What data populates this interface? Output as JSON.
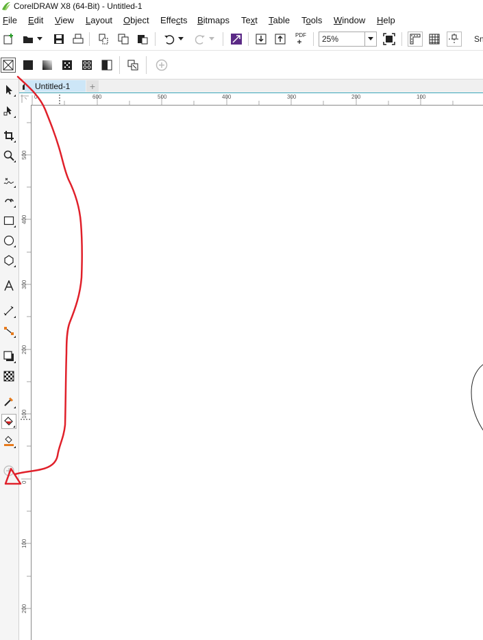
{
  "window": {
    "title": "CorelDRAW X8 (64-Bit) - Untitled-1"
  },
  "menu": [
    {
      "label": "File",
      "ul": "F",
      "rest": "ile"
    },
    {
      "label": "Edit",
      "ul": "E",
      "rest": "dit"
    },
    {
      "label": "View",
      "ul": "V",
      "rest": "iew"
    },
    {
      "label": "Layout",
      "ul": "L",
      "rest": "ayout"
    },
    {
      "label": "Object",
      "ul": "O",
      "rest": "bject"
    },
    {
      "label": "Effects",
      "pre": "Effe",
      "ul": "c",
      "rest": "ts"
    },
    {
      "label": "Bitmaps",
      "ul": "B",
      "rest": "itmaps"
    },
    {
      "label": "Text",
      "pre": "Te",
      "ul": "x",
      "rest": "t"
    },
    {
      "label": "Table",
      "ul": "T",
      "rest": "able"
    },
    {
      "label": "Tools",
      "pre": "T",
      "ul": "o",
      "rest": "ols"
    },
    {
      "label": "Window",
      "ul": "W",
      "rest": "indow"
    },
    {
      "label": "Help",
      "ul": "H",
      "rest": "elp"
    }
  ],
  "toolbar": {
    "zoom_value": "25%",
    "snap_label": "Sn",
    "pdf_label": "PDF"
  },
  "document_tab": {
    "label": "Untitled-1"
  },
  "ruler": {
    "horizontal": [
      "0",
      "600",
      "500",
      "400",
      "300",
      "200",
      "100"
    ],
    "vertical": [
      "500",
      "400",
      "300",
      "200",
      "100",
      "0",
      "100",
      "200"
    ]
  },
  "colors": {
    "annotation": "#e0202a",
    "tab_active": "#cde6f7",
    "tab_underline": "#3aa6b9",
    "logo_green": "#5db336"
  }
}
